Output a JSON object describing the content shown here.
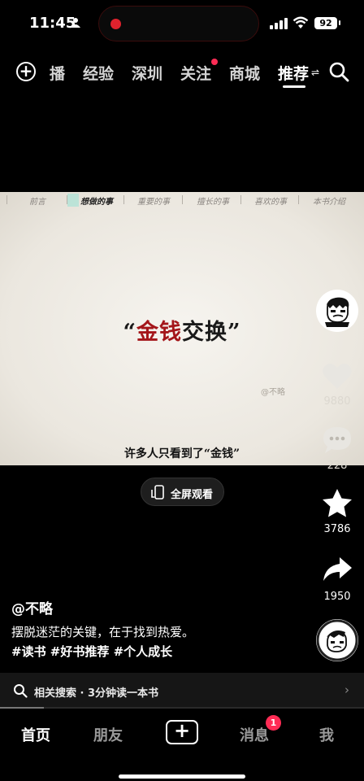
{
  "status_bar": {
    "time": "11:45",
    "battery": "92"
  },
  "top_nav": {
    "tabs": [
      "播",
      "经验",
      "深圳",
      "关注",
      "商城",
      "推荐"
    ],
    "active_tab": "推荐"
  },
  "video": {
    "chapters": [
      "前言",
      "想做的事",
      "重要的事",
      "擅长的事",
      "喜欢的事",
      "本书介绍"
    ],
    "active_chapter": "想做的事",
    "headline_open": "“",
    "headline_red": "金钱",
    "headline_rest": "交换”",
    "watermark": "@不略",
    "subtitle": "许多人只看到了“金钱”"
  },
  "fullscreen": {
    "label": "全屏观看"
  },
  "actions": {
    "likes": "9880",
    "comments": "228",
    "favorites": "3786",
    "shares": "1950"
  },
  "post": {
    "author": "@不略",
    "caption": "摆脱迷茫的关键，在于找到热爱。",
    "hashtags": "#读书 #好书推荐 #个人成长"
  },
  "related_search": {
    "label": "相关搜索 · 3分钟读一本书",
    "progress": 0.12
  },
  "bottom_tabs": {
    "home": "首页",
    "friends": "朋友",
    "messages": "消息",
    "messages_badge": "1",
    "me": "我"
  },
  "colors": {
    "accent": "#ff2c55",
    "headline_red": "#a4161a",
    "favorite": "#ffffff"
  }
}
